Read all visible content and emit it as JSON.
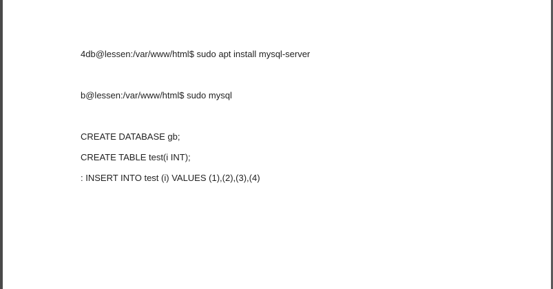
{
  "document": {
    "lines": [
      "4db@lessen:/var/www/html$ sudo apt install mysql-server",
      "b@lessen:/var/www/html$ sudo mysql",
      "CREATE DATABASE gb;",
      "CREATE TABLE test(i INT);",
      ": INSERT INTO test (i) VALUES (1),(2),(3),(4)"
    ]
  },
  "colors": {
    "page": "#ffffff",
    "text": "#1f1f1f",
    "frame": "#4a4a4a"
  }
}
